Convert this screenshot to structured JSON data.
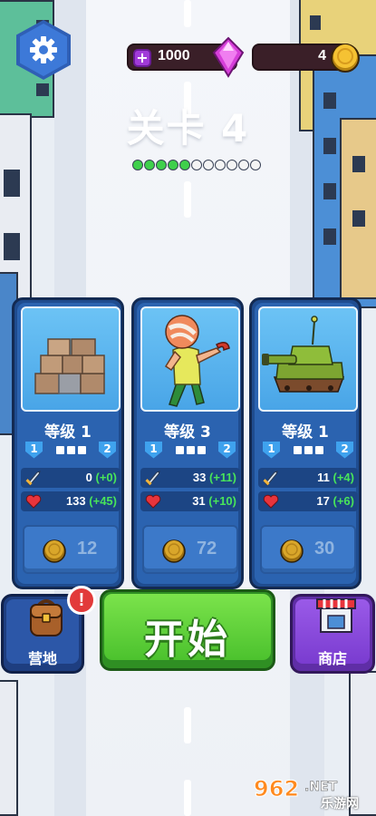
{
  "hud": {
    "gems": "1000",
    "coins": "4",
    "gem_plus": "+"
  },
  "level": {
    "title": "关卡 4",
    "progress_done": 5,
    "progress_total": 11
  },
  "cards": [
    {
      "name": "boxes",
      "level": "等级 1",
      "tier_from": "1",
      "tier_to": "2",
      "attack": "0",
      "attack_bonus": "(+0)",
      "hp": "133",
      "hp_bonus": "(+45)",
      "cost": "12"
    },
    {
      "name": "fighter",
      "level": "等级 3",
      "tier_from": "1",
      "tier_to": "2",
      "attack": "33",
      "attack_bonus": "(+11)",
      "hp": "31",
      "hp_bonus": "(+10)",
      "cost": "72"
    },
    {
      "name": "tank",
      "level": "等级 1",
      "tier_from": "1",
      "tier_to": "2",
      "attack": "11",
      "attack_bonus": "(+4)",
      "hp": "17",
      "hp_bonus": "(+6)",
      "cost": "30"
    }
  ],
  "bottom": {
    "camp_label": "营地",
    "alert": "!",
    "start_label": "开始",
    "shop_label": "商店"
  },
  "watermark": {
    "logo": "962.NET",
    "site": "乐游网"
  },
  "colors": {
    "card_bg": "#2b63b0",
    "bonus_green": "#48e45a",
    "start_green": "#4cc22e",
    "shop_purple": "#7a3cd0",
    "progress_done": "#3fd04b"
  }
}
